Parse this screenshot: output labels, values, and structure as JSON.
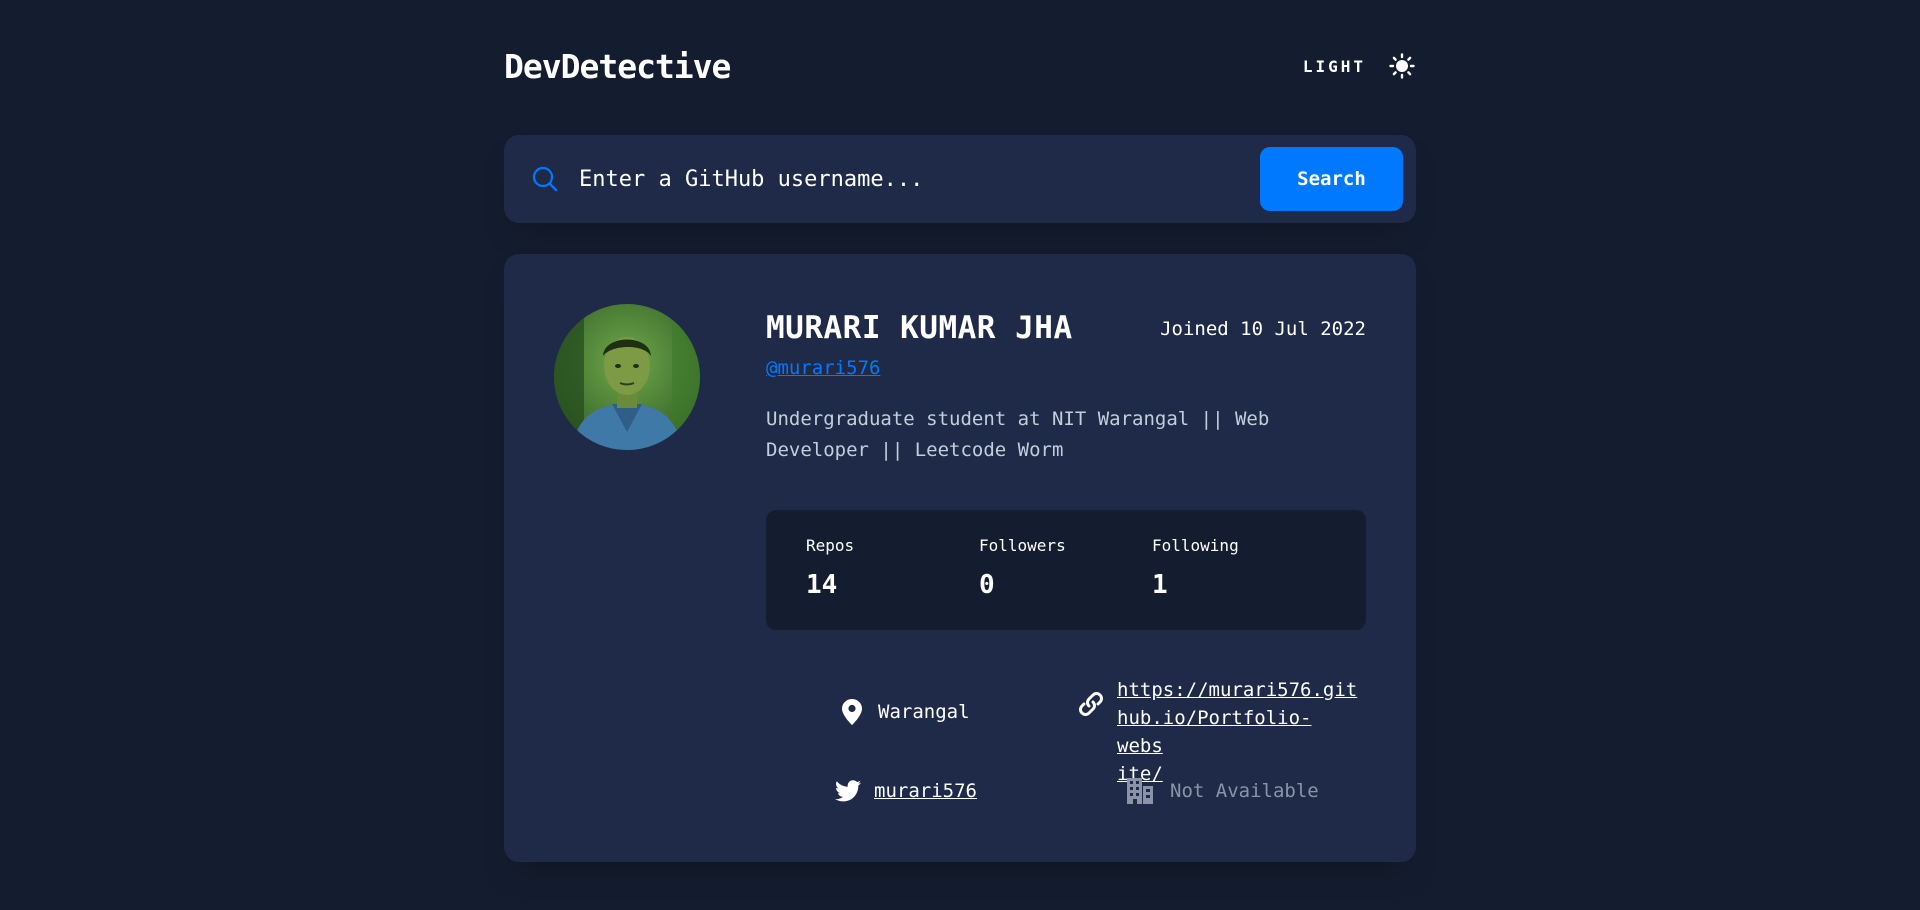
{
  "header": {
    "logo": "DevDetective",
    "mode_label": "LIGHT"
  },
  "search": {
    "placeholder": "Enter a GitHub username...",
    "button_label": "Search"
  },
  "profile": {
    "name": "MURARI KUMAR JHA",
    "joined": "Joined 10 Jul 2022",
    "username": "@murari576",
    "bio": "Undergraduate student at NIT Warangal || Web Developer || Leetcode Worm",
    "stats": {
      "repos_label": "Repos",
      "repos_value": "14",
      "followers_label": "Followers",
      "followers_value": "0",
      "following_label": "Following",
      "following_value": "1"
    },
    "links": {
      "location": "Warangal",
      "website_line1": "https://murari576.git",
      "website_line2": "hub.io/Portfolio-webs",
      "website_line3": "ite/",
      "twitter": "murari576",
      "company": "Not Available"
    }
  },
  "colors": {
    "background": "#141d2f",
    "card": "#1e2a47",
    "accent": "#0079ff",
    "muted": "#8b94a6"
  },
  "icons": [
    "sun-icon",
    "search-icon",
    "location-icon",
    "link-icon",
    "twitter-icon",
    "company-icon"
  ]
}
